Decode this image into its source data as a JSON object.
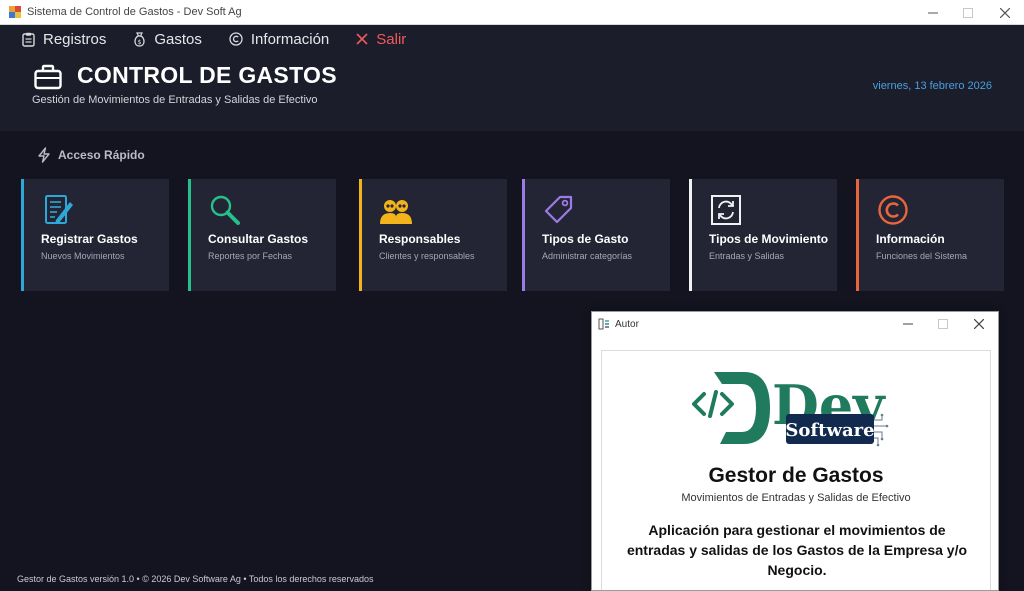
{
  "window": {
    "title": "Sistema de Control de Gastos  - Dev Soft Ag",
    "controls": [
      "minimize-icon",
      "maximize-icon",
      "close-icon"
    ]
  },
  "menu": [
    {
      "label": "Registros",
      "icon": "clipboard-icon"
    },
    {
      "label": "Gastos",
      "icon": "money-bag-icon"
    },
    {
      "label": "Información",
      "icon": "copyright-icon"
    },
    {
      "label": "Salir",
      "icon": "close-x-icon",
      "color": "#ef5a5a"
    }
  ],
  "header": {
    "title": "CONTROL DE GASTOS",
    "subtitle": "Gestión de Movimientos de Entradas y Salidas de Efectivo",
    "date": "viernes, 13 febrero 2026",
    "icon": "briefcase-icon"
  },
  "quick_access": {
    "label": "Acceso Rápido",
    "icon": "lightning-icon"
  },
  "cards": [
    {
      "title": "Registrar Gastos",
      "subtitle": "Nuevos Movimientos",
      "accent": "#2fa8d8",
      "icon": "edit-document-icon"
    },
    {
      "title": "Consultar Gastos",
      "subtitle": "Reportes por Fechas",
      "accent": "#27c08a",
      "icon": "magnifier-icon"
    },
    {
      "title": "Responsables",
      "subtitle": "Clientes y responsables",
      "accent": "#f3b31b",
      "icon": "users-icon"
    },
    {
      "title": "Tipos de Gasto",
      "subtitle": "Administrar categorías",
      "accent": "#9b7ce6",
      "icon": "tag-icon"
    },
    {
      "title": "Tipos de Movimiento",
      "subtitle": "Entradas y Salidas",
      "accent": "#f2f2f2",
      "icon": "refresh-icon"
    },
    {
      "title": "Información",
      "subtitle": "Funciones del Sistema",
      "accent": "#e9653e",
      "icon": "copyright-icon"
    }
  ],
  "footer": {
    "text": "Gestor de Gastos  versión 1.0  •  © 2026 Dev Software Ag  •  Todos los derechos reservados"
  },
  "dialog": {
    "title": "Autor",
    "logo_text_big": "Dev",
    "logo_text_small": "Software",
    "heading": "Gestor de Gastos",
    "subheading": "Movimientos de Entradas y Salidas de Efectivo",
    "description": "Aplicación para gestionar el movimientos de entradas y salidas de los Gastos de la Empresa y/o Negocio."
  },
  "colors": {
    "background": "#141420",
    "panel": "#1b1d2b",
    "card": "#232534",
    "date_text": "#4a9fe0",
    "logo_green": "#1f7a5e",
    "logo_navy": "#122a4e"
  }
}
